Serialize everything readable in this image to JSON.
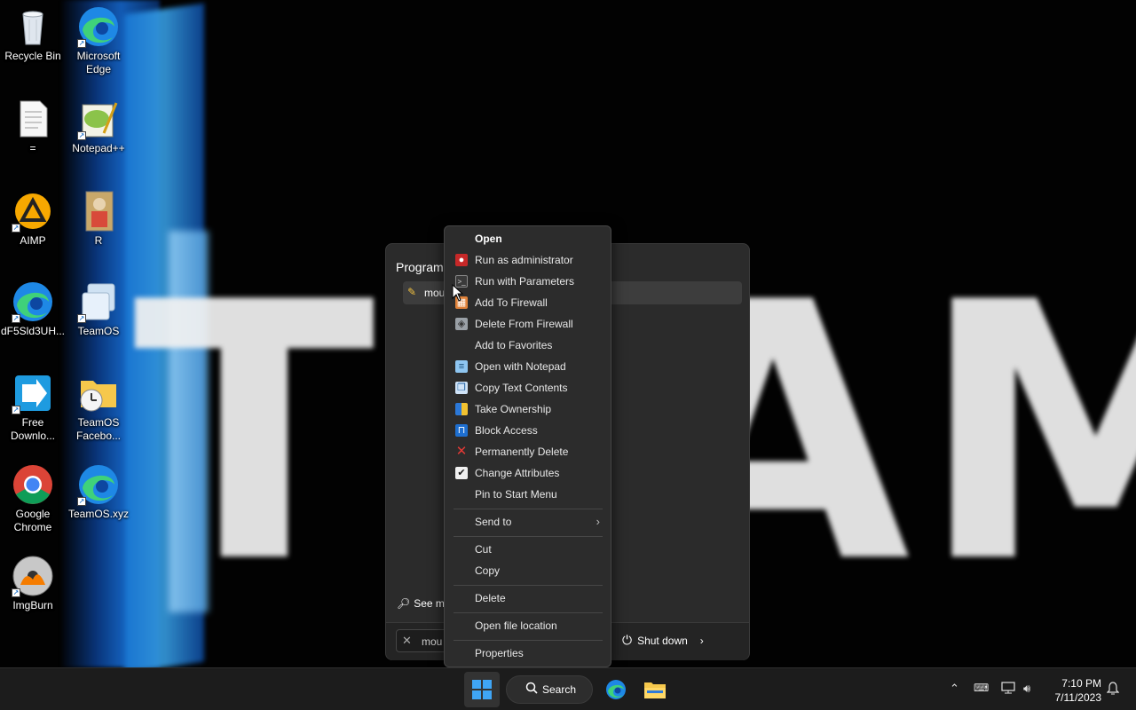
{
  "desktop": {
    "icons": [
      {
        "label": "Recycle Bin",
        "icon": "recycle-bin-icon"
      },
      {
        "label": "Microsoft Edge",
        "icon": "edge-icon"
      },
      {
        "label": "=",
        "icon": "text-file-icon"
      },
      {
        "label": "Notepad++",
        "icon": "notepad-plus-plus-icon"
      },
      {
        "label": "AIMP",
        "icon": "aimp-icon"
      },
      {
        "label": "R",
        "icon": "image-file-icon"
      },
      {
        "label": "dF5Sld3UH...",
        "icon": "edge-icon"
      },
      {
        "label": "TeamOS",
        "icon": "folder-app-icon"
      },
      {
        "label": "Free Downlo...",
        "icon": "free-download-manager-icon"
      },
      {
        "label": "TeamOS Facebo...",
        "icon": "folder-clock-icon"
      },
      {
        "label": "Google Chrome",
        "icon": "chrome-icon"
      },
      {
        "label": "TeamOS.xyz",
        "icon": "edge-icon"
      },
      {
        "label": "ImgBurn",
        "icon": "imgburn-icon"
      }
    ]
  },
  "start_panel": {
    "heading": "Programs",
    "result_label": "mou",
    "see_more": "See mo",
    "search_text": "mou",
    "shutdown_label": "Shut down"
  },
  "context_menu": {
    "items": [
      {
        "label": "Open",
        "icon": ""
      },
      {
        "label": "Run as administrator",
        "icon": "shield-icon"
      },
      {
        "label": "Run with Parameters",
        "icon": "terminal-icon"
      },
      {
        "label": "Add To Firewall",
        "icon": "firewall-add-icon"
      },
      {
        "label": "Delete From Firewall",
        "icon": "firewall-delete-icon"
      },
      {
        "label": "Add to Favorites",
        "icon": ""
      },
      {
        "label": "Open with Notepad",
        "icon": "notepad-icon"
      },
      {
        "label": "Copy Text Contents",
        "icon": "copy-text-icon"
      },
      {
        "label": "Take Ownership",
        "icon": "uac-shield-icon"
      },
      {
        "label": "Block Access",
        "icon": "lock-icon"
      },
      {
        "label": "Permanently Delete",
        "icon": "red-x-icon"
      },
      {
        "label": "Change Attributes",
        "icon": "checkbox-icon"
      },
      {
        "label": "Pin to Start Menu",
        "icon": ""
      },
      {
        "label": "Send to",
        "icon": ""
      },
      {
        "label": "Cut",
        "icon": ""
      },
      {
        "label": "Copy",
        "icon": ""
      },
      {
        "label": "Delete",
        "icon": ""
      },
      {
        "label": "Open file location",
        "icon": ""
      },
      {
        "label": "Properties",
        "icon": ""
      }
    ]
  },
  "taskbar": {
    "search_label": "Search",
    "time": "7:10 PM",
    "date": "7/11/2023"
  },
  "colors": {
    "accent": "#3fa5f5",
    "menu_bg": "#2c2c2c",
    "taskbar_bg": "#1c1c1c"
  }
}
